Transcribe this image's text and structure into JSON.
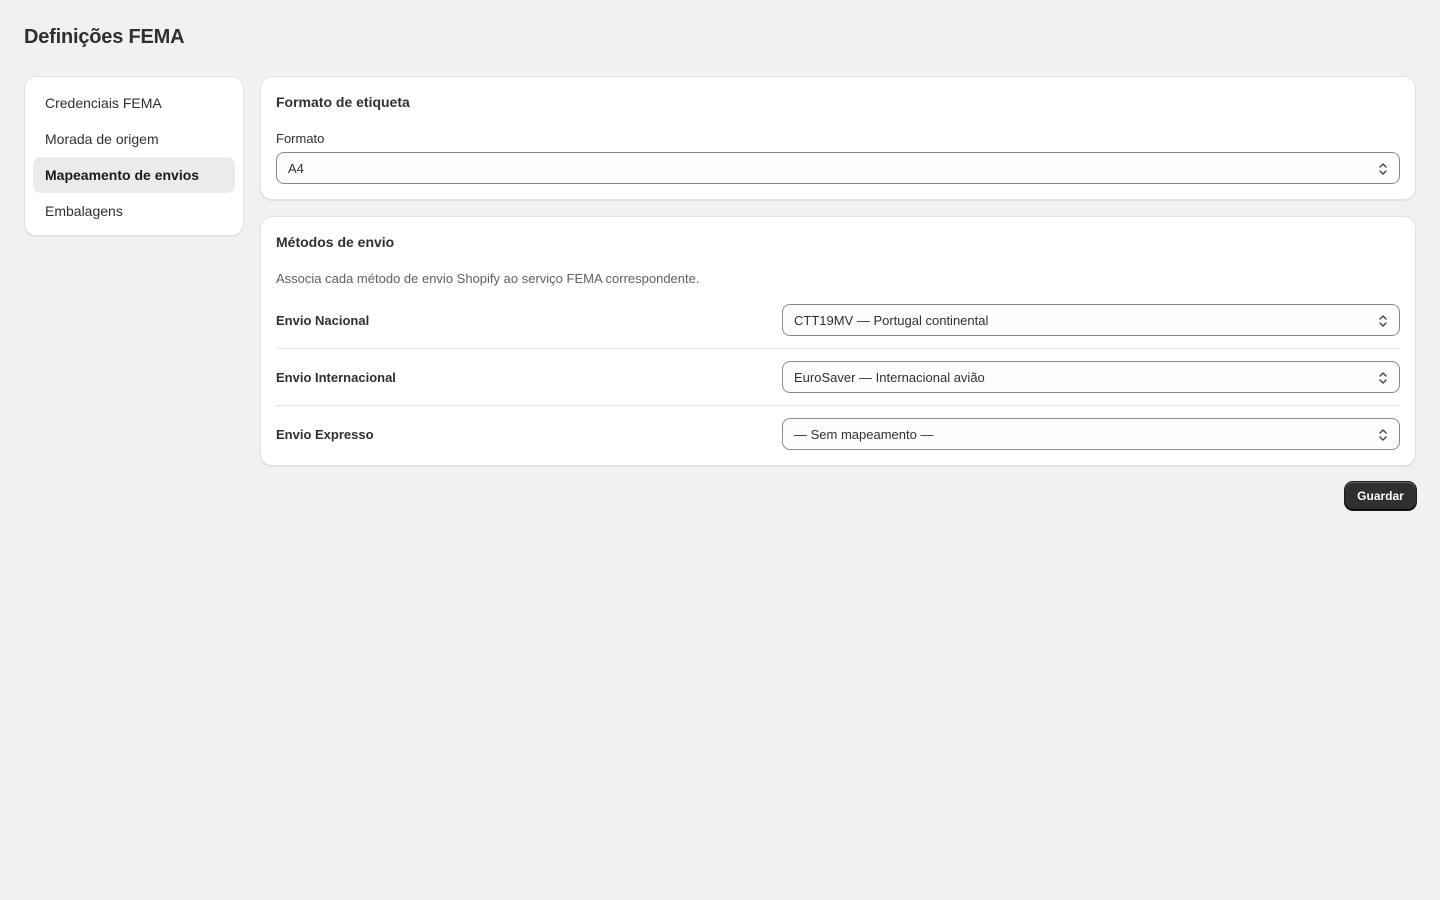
{
  "page": {
    "title": "Definições FEMA"
  },
  "nav": {
    "items": [
      {
        "label": "Credenciais FEMA",
        "active": false
      },
      {
        "label": "Morada de origem",
        "active": false
      },
      {
        "label": "Mapeamento de envios",
        "active": true
      },
      {
        "label": "Embalagens",
        "active": false
      }
    ]
  },
  "label_format": {
    "title": "Formato de etiqueta",
    "field_label": "Formato",
    "selected": "A4"
  },
  "shipping_methods": {
    "title": "Métodos de envio",
    "description": "Associa cada método de envio Shopify ao serviço FEMA correspondente.",
    "rows": [
      {
        "label": "Envio Nacional",
        "selected": "CTT19MV — Portugal continental"
      },
      {
        "label": "Envio Internacional",
        "selected": "EuroSaver — Internacional avião"
      },
      {
        "label": "Envio Expresso",
        "selected": "— Sem mapeamento —"
      }
    ]
  },
  "actions": {
    "save_label": "Guardar"
  },
  "icons": {
    "select_chevron": "chevron-up-down-icon"
  },
  "colors": {
    "background": "#f1f1f1",
    "card": "#ffffff",
    "primary_button": "#303030",
    "active_nav": "#ebebeb"
  }
}
